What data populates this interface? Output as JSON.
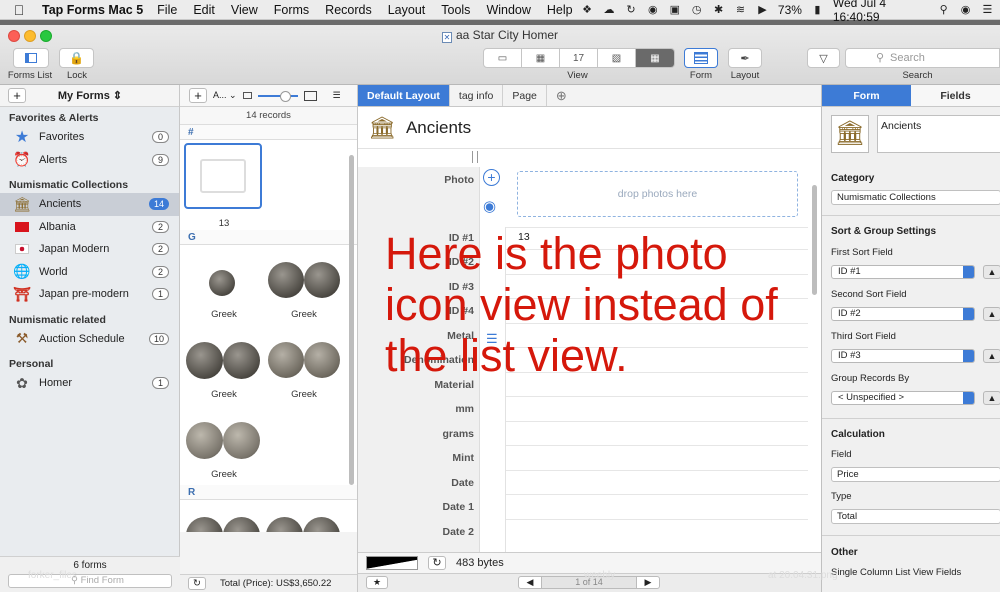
{
  "menubar": {
    "app_name": "Tap Forms Mac 5",
    "items": [
      "File",
      "Edit",
      "View",
      "Forms",
      "Records",
      "Layout",
      "Tools",
      "Window",
      "Help"
    ],
    "battery": "73%",
    "clock": "Wed Jul 4  16:40:59"
  },
  "window": {
    "title": "aa Star City Homer"
  },
  "toolbar": {
    "forms_list_label": "Forms List",
    "lock_label": "Lock",
    "view_label": "View",
    "form_label": "Form",
    "layout_label": "Layout",
    "search_placeholder": "Search",
    "search_label": "Search"
  },
  "sidebar": {
    "header_title": "My Forms",
    "sections": [
      {
        "title": "Favorites & Alerts",
        "items": [
          {
            "label": "Favorites",
            "count": "0",
            "icon": "star-icon"
          },
          {
            "label": "Alerts",
            "count": "9",
            "icon": "alarm-clock-icon"
          }
        ]
      },
      {
        "title": "Numismatic Collections",
        "items": [
          {
            "label": "Ancients",
            "count": "14",
            "icon": "temple-icon"
          },
          {
            "label": "Albania",
            "count": "2",
            "icon": "albania-flag-icon"
          },
          {
            "label": "Japan Modern",
            "count": "2",
            "icon": "japan-flag-icon"
          },
          {
            "label": "World",
            "count": "2",
            "icon": "globe-icon"
          },
          {
            "label": "Japan pre-modern",
            "count": "1",
            "icon": "torii-gate-icon"
          }
        ]
      },
      {
        "title": "Numismatic related",
        "items": [
          {
            "label": "Auction Schedule",
            "count": "10",
            "icon": "gavel-icon"
          }
        ]
      },
      {
        "title": "Personal",
        "items": [
          {
            "label": "Homer",
            "count": "1",
            "icon": "paw-icon"
          }
        ]
      }
    ],
    "footer_count": "6 forms",
    "find_placeholder": "Find Form"
  },
  "record_list": {
    "sort_label": "A...",
    "record_count": "14 records",
    "groups": [
      {
        "letter": "#",
        "tiles": [
          "13"
        ]
      },
      {
        "letter": "G",
        "tiles": [
          "Greek",
          "Greek",
          "Greek",
          "Greek",
          "Greek"
        ]
      },
      {
        "letter": "R",
        "tiles": []
      }
    ],
    "footer_total": "Total (Price): US$3,650.22"
  },
  "layout_tabs": [
    "Default Layout",
    "tag info",
    "Page"
  ],
  "record": {
    "title": "Ancients",
    "drop_text": "drop photos here",
    "field_labels": [
      "Photo",
      "ID #1",
      "ID #2",
      "ID #3",
      "ID #4",
      "Metal",
      "Denomination",
      "Material",
      "mm",
      "grams",
      "Mint",
      "Date",
      "Date 1",
      "Date 2"
    ],
    "id1_value": "13",
    "footer_bytes": "483 bytes",
    "pager": "1 of 14"
  },
  "annotation": {
    "text": "Here is the photo icon view instead of the list view."
  },
  "inspector": {
    "tabs": [
      "Form",
      "Fields"
    ],
    "form_name": "Ancients",
    "category_heading": "Category",
    "category_value": "Numismatic Collections",
    "sort_heading": "Sort & Group Settings",
    "first_sort_label": "First Sort Field",
    "first_sort_value": "ID #1",
    "second_sort_label": "Second Sort Field",
    "second_sort_value": "ID #2",
    "third_sort_label": "Third Sort Field",
    "third_sort_value": "ID #3",
    "group_label": "Group Records By",
    "group_value": "< Unspecified >",
    "calc_heading": "Calculation",
    "calc_field_label": "Field",
    "calc_field_value": "Price",
    "calc_type_label": "Type",
    "calc_type_value": "Total",
    "other_heading": "Other",
    "other_item": "Single Column List View Fields"
  },
  "desktop": {
    "left_text": "forker_files",
    "mid_text": "weebly",
    "right_text": "at 20.04.31.png"
  },
  "colors": {
    "accent": "#3d7bd6",
    "annotation": "#d5180b"
  }
}
